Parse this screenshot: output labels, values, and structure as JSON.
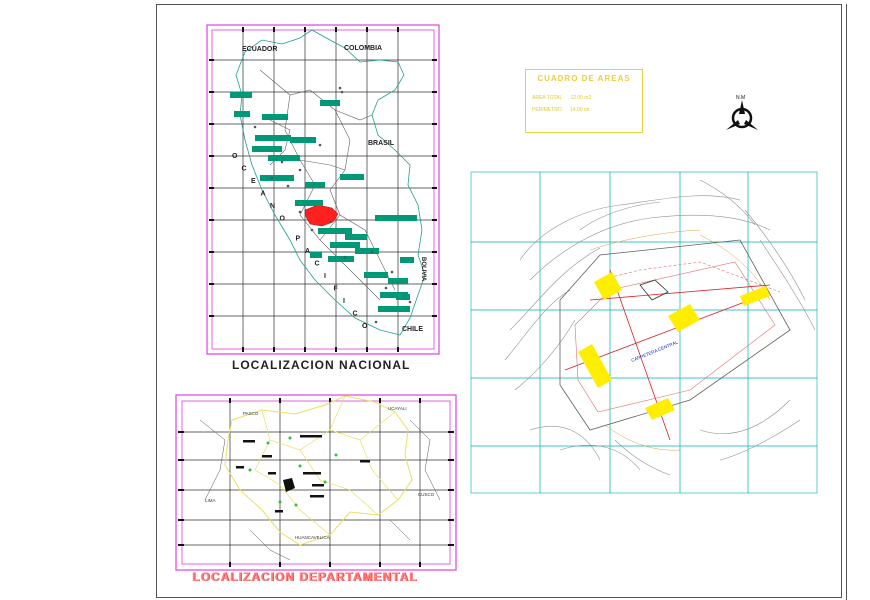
{
  "national_map": {
    "title": "LOCALIZACION NACIONAL",
    "countries": {
      "ecuador": "ECUADOR",
      "colombia": "COLOMBIA",
      "brasil": "BRASIL",
      "bolivia": "BOLIVIA",
      "chile": "CHILE"
    },
    "ocean_letters": [
      "O",
      "C",
      "E",
      "A",
      "N",
      "O",
      "P",
      "A",
      "C",
      "I",
      "F",
      "I",
      "C",
      "O"
    ]
  },
  "departmental_map": {
    "title": "LOCALIZACION DEPARTAMENTAL",
    "labels": {
      "pasco": "PASCO",
      "ucayali": "UCAYALI",
      "lima": "LIMA",
      "cusco": "CUSCO",
      "huancavelica": "HUANCAVELICA"
    }
  },
  "areas_table": {
    "title": "CUADRO DE AREAS",
    "rows": [
      {
        "label": "AREA TOTAL",
        "value": "12.00 m2"
      },
      {
        "label": "PERIMETRO",
        "value": "14.00 ml"
      }
    ]
  },
  "north_arrow": {
    "label": "N.M"
  },
  "site_plan": {
    "road_label": "CARRETERA CENTRAL"
  },
  "colors": {
    "frame_magenta": "#e040e0",
    "grid": "#202020",
    "province_label": "#009977",
    "highlight": "#ff2020",
    "yellow": "#ffee00",
    "cyan_grid": "#00b0b0"
  }
}
